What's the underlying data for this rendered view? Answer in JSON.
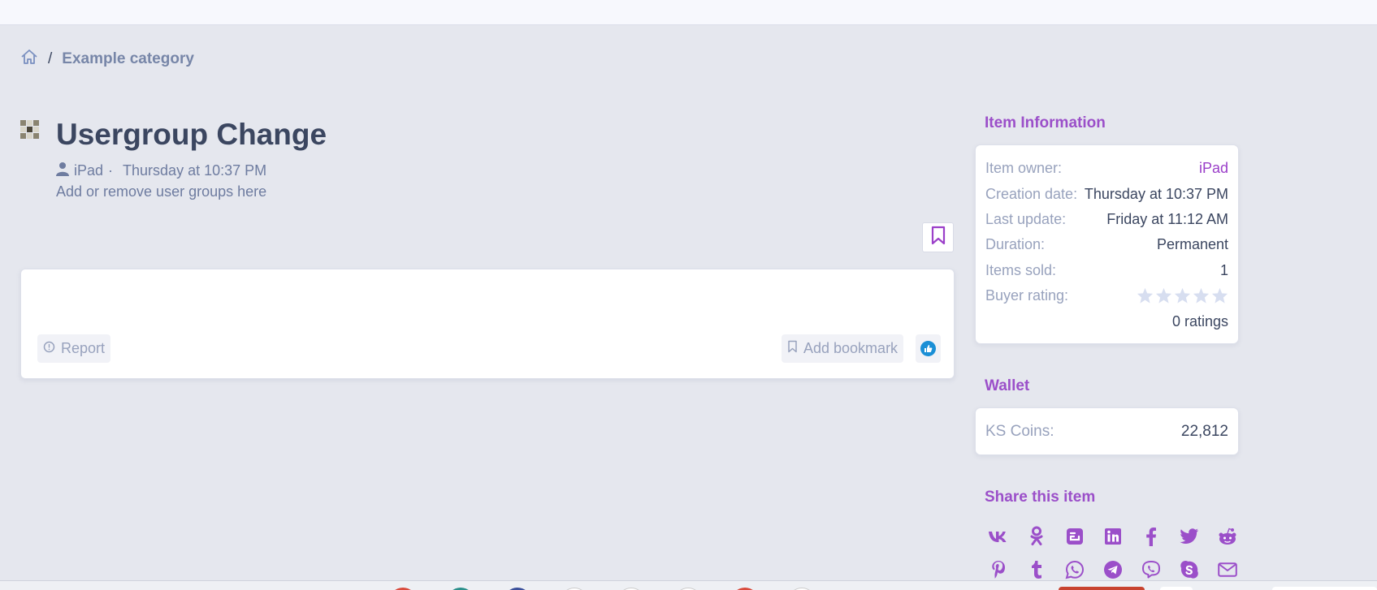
{
  "breadcrumb": {
    "home_icon": "home-icon",
    "separator": "/",
    "category": "Example category"
  },
  "item": {
    "title": "Usergroup Change",
    "author": "iPad",
    "meta_separator": "·",
    "date": "Thursday at 10:37 PM",
    "description": "Add or remove user groups here"
  },
  "actions": {
    "report": "Report",
    "add_bookmark": "Add bookmark"
  },
  "item_info": {
    "title": "Item Information",
    "rows": [
      {
        "label": "Item owner:",
        "value": "iPad"
      },
      {
        "label": "Creation date:",
        "value": "Thursday at 10:37 PM"
      },
      {
        "label": "Last update:",
        "value": "Friday at 11:12 AM"
      },
      {
        "label": "Duration:",
        "value": "Permanent"
      },
      {
        "label": "Items sold:",
        "value": "1"
      },
      {
        "label": "Buyer rating:",
        "value": ""
      }
    ],
    "rating_count": "0 ratings",
    "rating_stars": 0
  },
  "wallet": {
    "title": "Wallet",
    "label": "KS Coins:",
    "value": "22,812"
  },
  "share": {
    "title": "Share this item",
    "icons": [
      "vk-icon",
      "odnoklassniki-icon",
      "blogger-icon",
      "linkedin-icon",
      "facebook-icon",
      "twitter-icon",
      "reddit-icon",
      "pinterest-icon",
      "tumblr-icon",
      "whatsapp-icon",
      "telegram-icon",
      "viber-icon",
      "skype-icon",
      "email-icon"
    ]
  },
  "colors": {
    "accent": "#9b4fc9",
    "background": "#e5e7ee",
    "muted": "#98a2bd",
    "text": "#3b4660"
  }
}
